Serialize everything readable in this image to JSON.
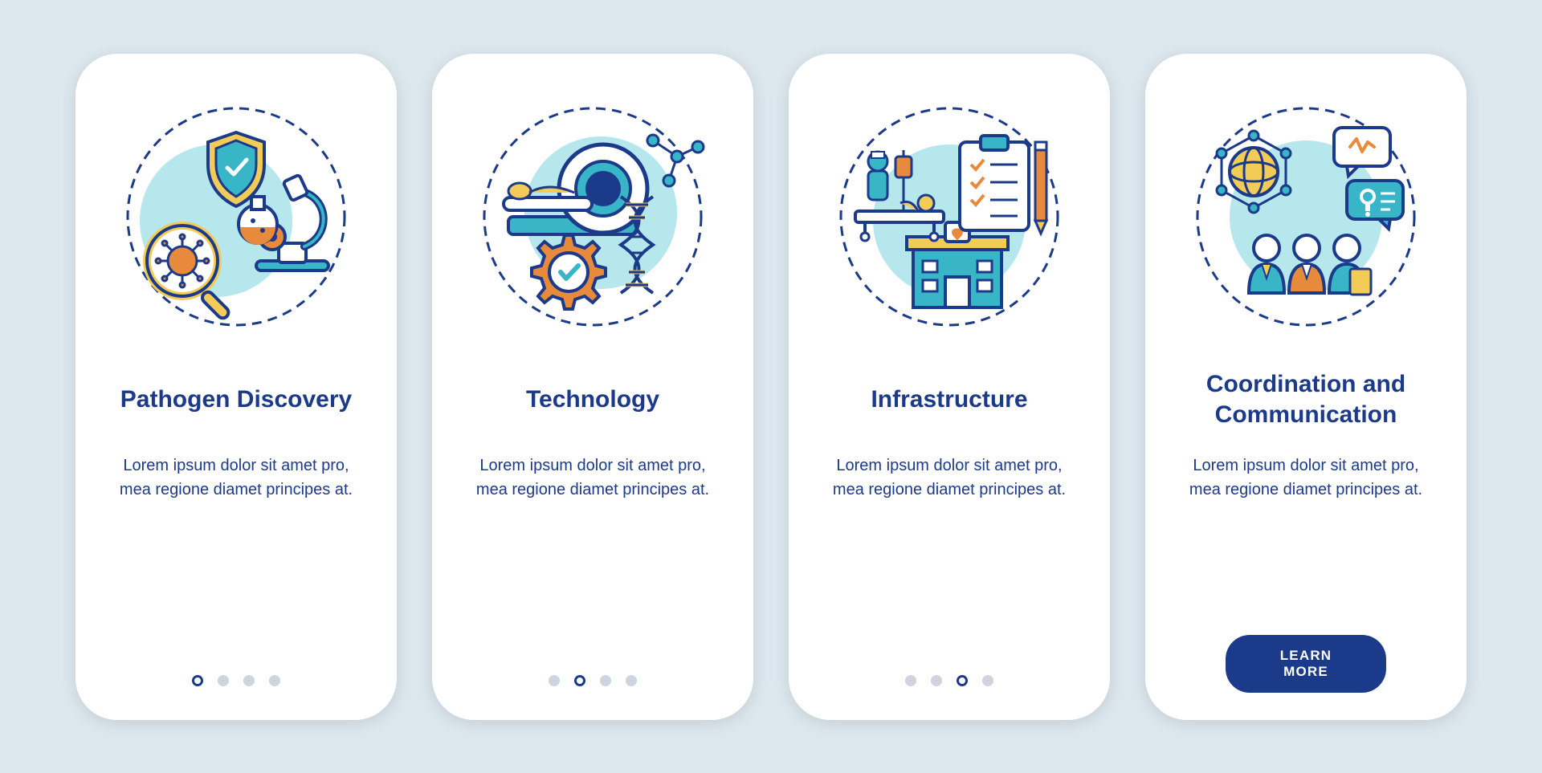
{
  "colors": {
    "navy": "#1c3a8a",
    "teal": "#38b6c7",
    "teal_light": "#b5e7ec",
    "orange": "#e88a3c",
    "yellow": "#f3cb57",
    "grey_dot": "#cfd5de",
    "bg": "#dbe6ed"
  },
  "screens": [
    {
      "title": "Pathogen Discovery",
      "description": "Lorem ipsum dolor sit amet pro, mea regione diamet principes at.",
      "active_dot": 0,
      "show_cta": false,
      "illustration": "pathogen-discovery"
    },
    {
      "title": "Technology",
      "description": "Lorem ipsum dolor sit amet pro, mea regione diamet principes at.",
      "active_dot": 1,
      "show_cta": false,
      "illustration": "technology"
    },
    {
      "title": "Infrastructure",
      "description": "Lorem ipsum dolor sit amet pro, mea regione diamet principes at.",
      "active_dot": 2,
      "show_cta": false,
      "illustration": "infrastructure"
    },
    {
      "title": "Coordination and Communication",
      "description": "Lorem ipsum dolor sit amet pro, mea regione diamet principes at.",
      "active_dot": 3,
      "show_cta": true,
      "illustration": "coordination"
    }
  ],
  "cta_label": "LEARN MORE",
  "dot_count": 4
}
